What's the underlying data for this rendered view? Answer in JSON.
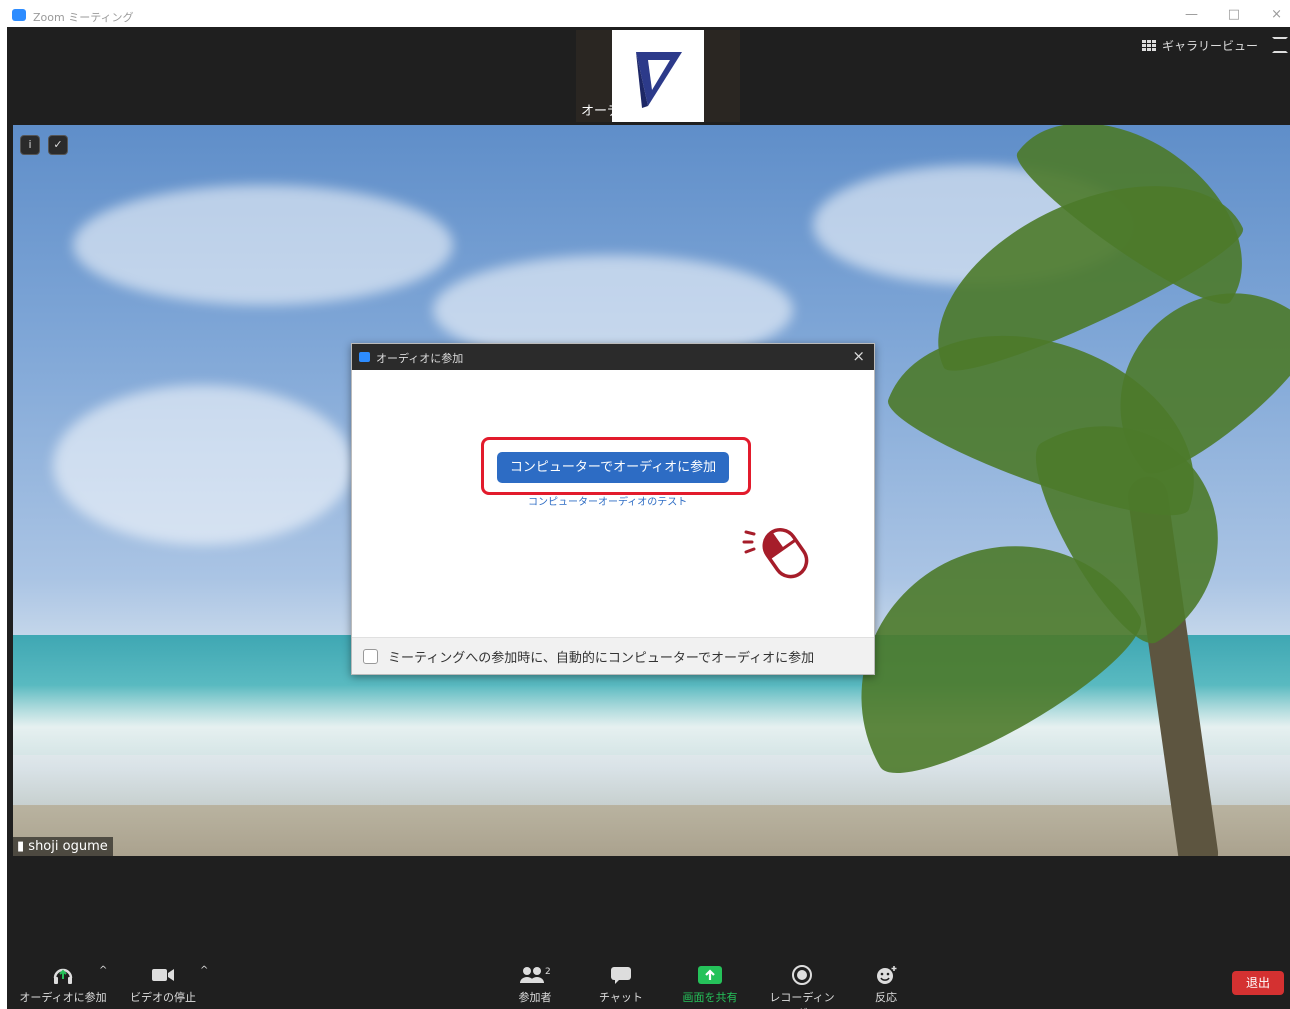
{
  "window": {
    "title": "Zoom ミーティング",
    "controls": {
      "minimize": "—",
      "maximize": "□",
      "close": "×"
    }
  },
  "top_strip": {
    "thumbnail_name": "オーデ",
    "view_button_label": "ギャラリービュー"
  },
  "video": {
    "participant_name": "shoji ogume"
  },
  "dialog": {
    "title": "オーディオに参加",
    "close": "×",
    "join_button_label": "コンピューターでオーディオに参加",
    "test_link": "コンピューターオーディオのテスト",
    "auto_join_label": "ミーティングへの参加時に、自動的にコンピューターでオーディオに参加",
    "auto_join_checked": false
  },
  "toolbar": {
    "audio_label": "オーディオに参加",
    "video_label": "ビデオの停止",
    "participants_label": "参加者",
    "participants_count": "2",
    "chat_label": "チャット",
    "share_label": "画面を共有",
    "record_label": "レコーディング",
    "reactions_label": "反応",
    "leave_label": "退出",
    "caret": "^"
  },
  "colors": {
    "accent_blue": "#2d6cc4",
    "highlight_red": "#e21b2c",
    "share_green": "#25c25a",
    "leave_red": "#d43131",
    "background": "#1f1f1f"
  }
}
